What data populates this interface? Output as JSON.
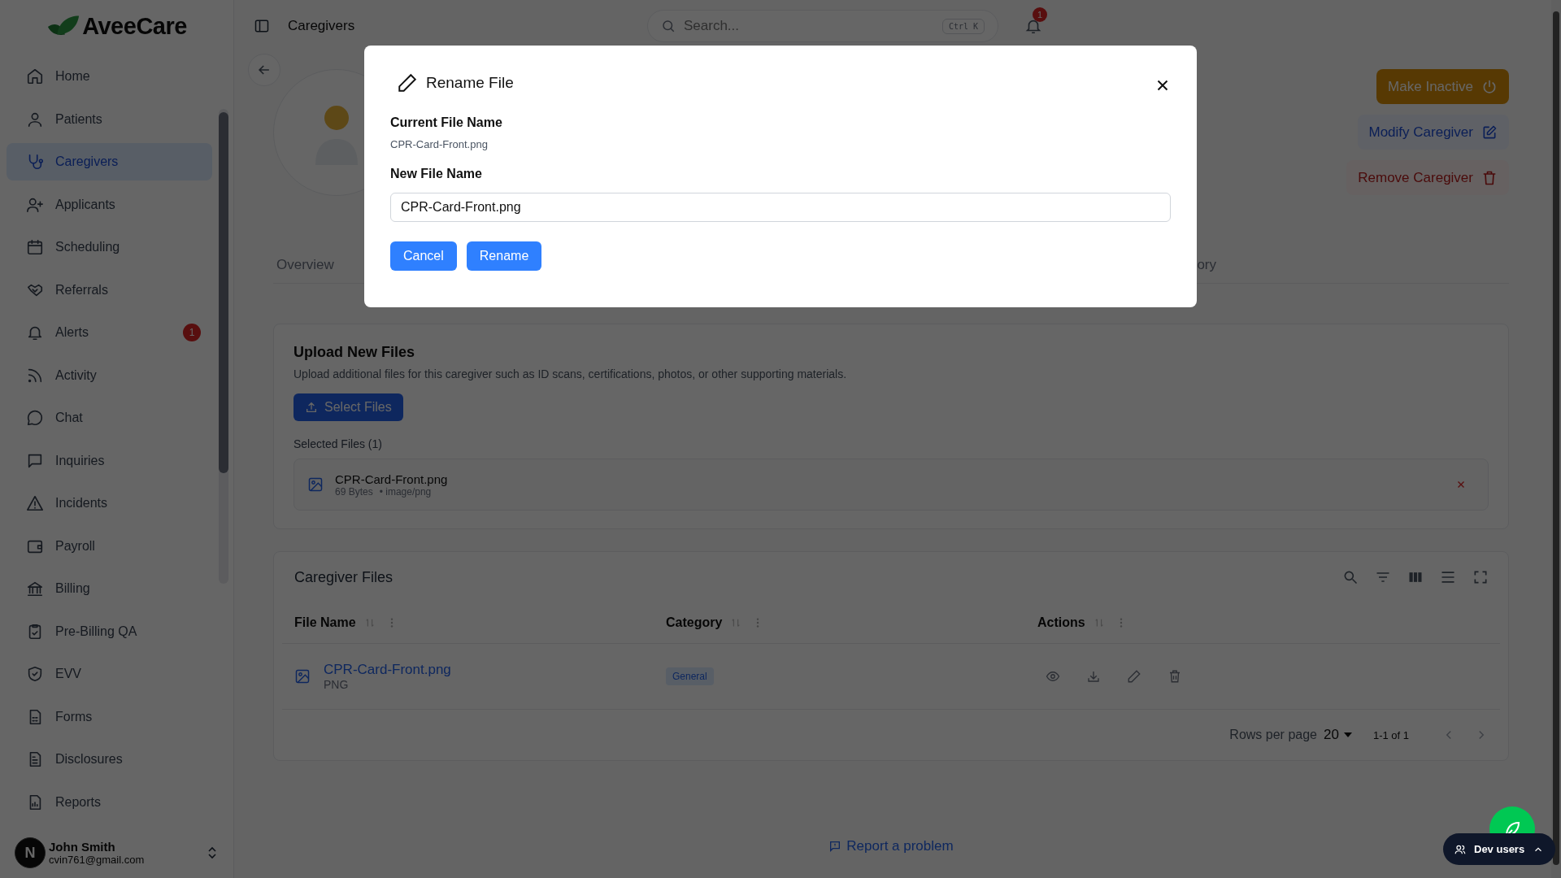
{
  "app": {
    "logo": "AveeCare"
  },
  "sidebar": {
    "items": [
      {
        "label": "Home",
        "selected": false
      },
      {
        "label": "Patients",
        "selected": false
      },
      {
        "label": "Caregivers",
        "selected": true
      },
      {
        "label": "Applicants",
        "selected": false
      },
      {
        "label": "Scheduling",
        "selected": false
      },
      {
        "label": "Referrals",
        "selected": false
      },
      {
        "label": "Alerts",
        "selected": false,
        "badge": "1"
      },
      {
        "label": "Activity",
        "selected": false
      },
      {
        "label": "Chat",
        "selected": false
      },
      {
        "label": "Inquiries",
        "selected": false
      },
      {
        "label": "Incidents",
        "selected": false
      },
      {
        "label": "Payroll",
        "selected": false
      },
      {
        "label": "Billing",
        "selected": false
      },
      {
        "label": "Pre-Billing QA",
        "selected": false
      },
      {
        "label": "EVV",
        "selected": false
      },
      {
        "label": "Forms",
        "selected": false
      },
      {
        "label": "Disclosures",
        "selected": false
      },
      {
        "label": "Reports",
        "selected": false
      }
    ],
    "user": {
      "initial": "N",
      "name": "John Smith",
      "email": "cvin761@gmail.com"
    }
  },
  "topbar": {
    "title": "Caregivers",
    "search": {
      "placeholder": "Search...",
      "shortcut": "Ctrl K"
    },
    "notifications": "1"
  },
  "profile": {
    "actions": [
      {
        "label": "Make Inactive",
        "kind": "warning"
      },
      {
        "label": "Modify Caregiver",
        "kind": "primary"
      },
      {
        "label": "Remove Caregiver",
        "kind": "danger"
      }
    ]
  },
  "tabs": [
    {
      "label": "Overview"
    },
    {
      "label": "ory"
    }
  ],
  "upload": {
    "title": "Upload New Files",
    "description": "Upload additional files for this caregiver such as ID scans, certifications, photos, or other supporting materials.",
    "button": "Select Files",
    "selected_label": "Selected Files (1)",
    "files": [
      {
        "name": "CPR-Card-Front.png",
        "size": "69 Bytes",
        "type": "• image/png"
      }
    ]
  },
  "files_table": {
    "title": "Caregiver Files",
    "columns": [
      "File Name",
      "Category",
      "Actions"
    ],
    "rows": [
      {
        "name": "CPR-Card-Front.png",
        "type": "PNG",
        "category": "General"
      }
    ],
    "footer": {
      "rows_label": "Rows per page",
      "rows_value": "20",
      "range": "1-1 of 1"
    }
  },
  "footer": {
    "report_link": "Report a problem"
  },
  "dev_widget": {
    "label": "Dev users"
  },
  "dialog": {
    "title": "Rename File",
    "current_label": "Current File Name",
    "current_value": "CPR-Card-Front.png",
    "new_label": "New File Name",
    "new_value": "CPR-Card-Front.png",
    "buttons": [
      {
        "label": "Cancel"
      },
      {
        "label": "Rename"
      }
    ]
  }
}
